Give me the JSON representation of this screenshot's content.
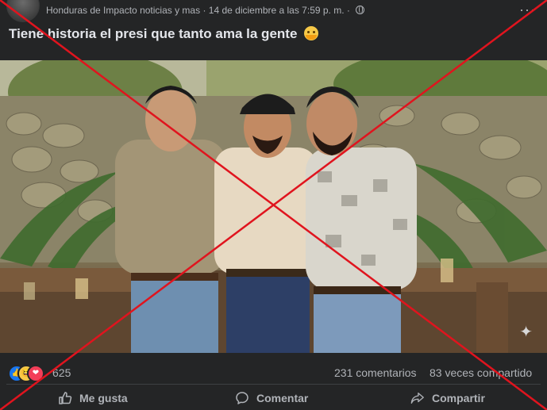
{
  "post": {
    "page_name": "Honduras de Impacto noticias y mas",
    "separator": "·",
    "timestamp": "14 de diciembre a las 7:59 p. m.",
    "separator2": "·",
    "more_label": "···",
    "text": "Tiene historia el presi que tanto ama la gente",
    "emoji": "hugging-face-emoji"
  },
  "stats": {
    "reactions_count": "625",
    "comments": "231 comentarios",
    "shares": "83 veces compartido",
    "reaction_icons": [
      "like-icon",
      "haha-icon",
      "love-icon"
    ]
  },
  "actions": {
    "like": "Me gusta",
    "comment": "Comentar",
    "share": "Compartir"
  },
  "overlay": {
    "cross_color": "#e0141e"
  },
  "colors": {
    "background": "#242526",
    "text_primary": "#e4e6eb",
    "text_secondary": "#b0b3b8",
    "like_blue": "#1877f2"
  }
}
